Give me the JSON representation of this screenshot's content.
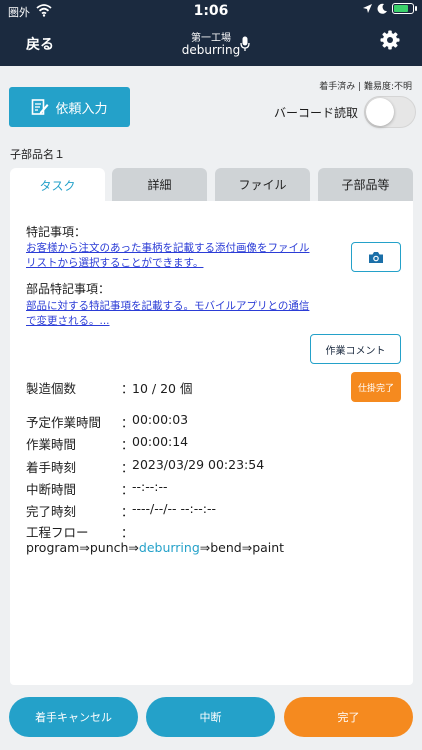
{
  "status_bar": {
    "carrier": "圏外",
    "time": "1:06"
  },
  "nav": {
    "back_label": "戻る",
    "subtitle": "第一工場",
    "title": "deburring"
  },
  "meta": {
    "text": "着手済み | 難易度:不明"
  },
  "request_button": {
    "label": "依頼入力"
  },
  "barcode": {
    "label": "バーコード読取",
    "enabled": false
  },
  "subpart_name": "子部品名１",
  "tabs": [
    {
      "label": "タスク",
      "active": true
    },
    {
      "label": "詳細",
      "active": false
    },
    {
      "label": "ファイル",
      "active": false
    },
    {
      "label": "子部品等",
      "active": false
    }
  ],
  "task": {
    "special_notes_label": "特記事項：",
    "special_notes_text_line1": "お客様から注文のあった事柄を記載する添付画像をファイル",
    "special_notes_text_line2": "リストから選択することができます。",
    "part_notes_label": "部品特記事項：",
    "part_notes_text_line1": "部品に対する特記事項を記載する。モバイルアプリとの通信",
    "part_notes_text_line2": "で変更される。...",
    "comment_button": "作業コメント",
    "partial_complete_button": "仕掛完了",
    "fields": [
      {
        "label": "製造個数",
        "value": "10 / 20 個"
      },
      {
        "label": "予定作業時間",
        "value": "00:00:03"
      },
      {
        "label": "作業時間",
        "value": "00:00:14"
      },
      {
        "label": "着手時刻",
        "value": "2023/03/29 00:23:54"
      },
      {
        "label": "中断時間",
        "value": "--:--:--"
      },
      {
        "label": "完了時刻",
        "value": "----/--/-- --:--:--"
      }
    ],
    "flow_label": "工程フロー",
    "flow_before": "program⇒punch⇒",
    "flow_current": "deburring",
    "flow_after": "⇒bend⇒paint"
  },
  "bottom_buttons": {
    "cancel": "着手キャンセル",
    "interrupt": "中断",
    "complete": "完了"
  },
  "colors": {
    "nav_bg": "#1b2a3f",
    "accent": "#24a1c9",
    "orange": "#f58a1f",
    "link": "#2b3cd6"
  }
}
